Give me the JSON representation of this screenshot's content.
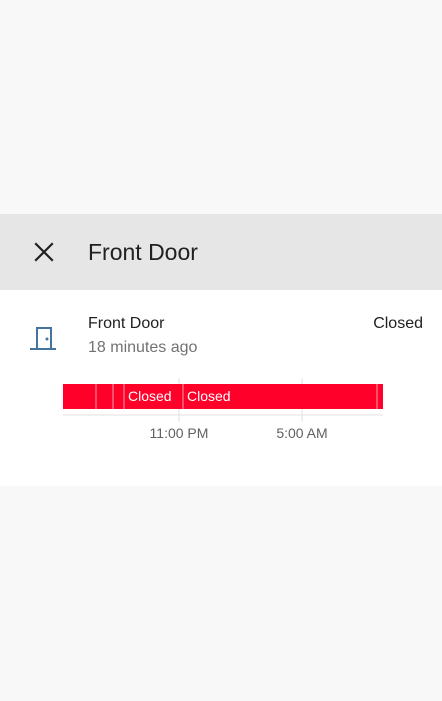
{
  "dialog": {
    "title": "Front Door",
    "close_icon": "close-icon"
  },
  "entity": {
    "name": "Front Door",
    "last_changed": "18 minutes ago",
    "state": "Closed",
    "icon": "door-closed-icon",
    "icon_color": "#44739e"
  },
  "timeline": {
    "bar_color": "#ff0029",
    "segments": [
      {
        "label": ""
      },
      {
        "label": ""
      },
      {
        "label": ""
      },
      {
        "label": "Closed"
      },
      {
        "label": "Closed"
      },
      {
        "label": ""
      }
    ],
    "ticks": [
      "11:00 PM",
      "5:00 AM"
    ]
  }
}
